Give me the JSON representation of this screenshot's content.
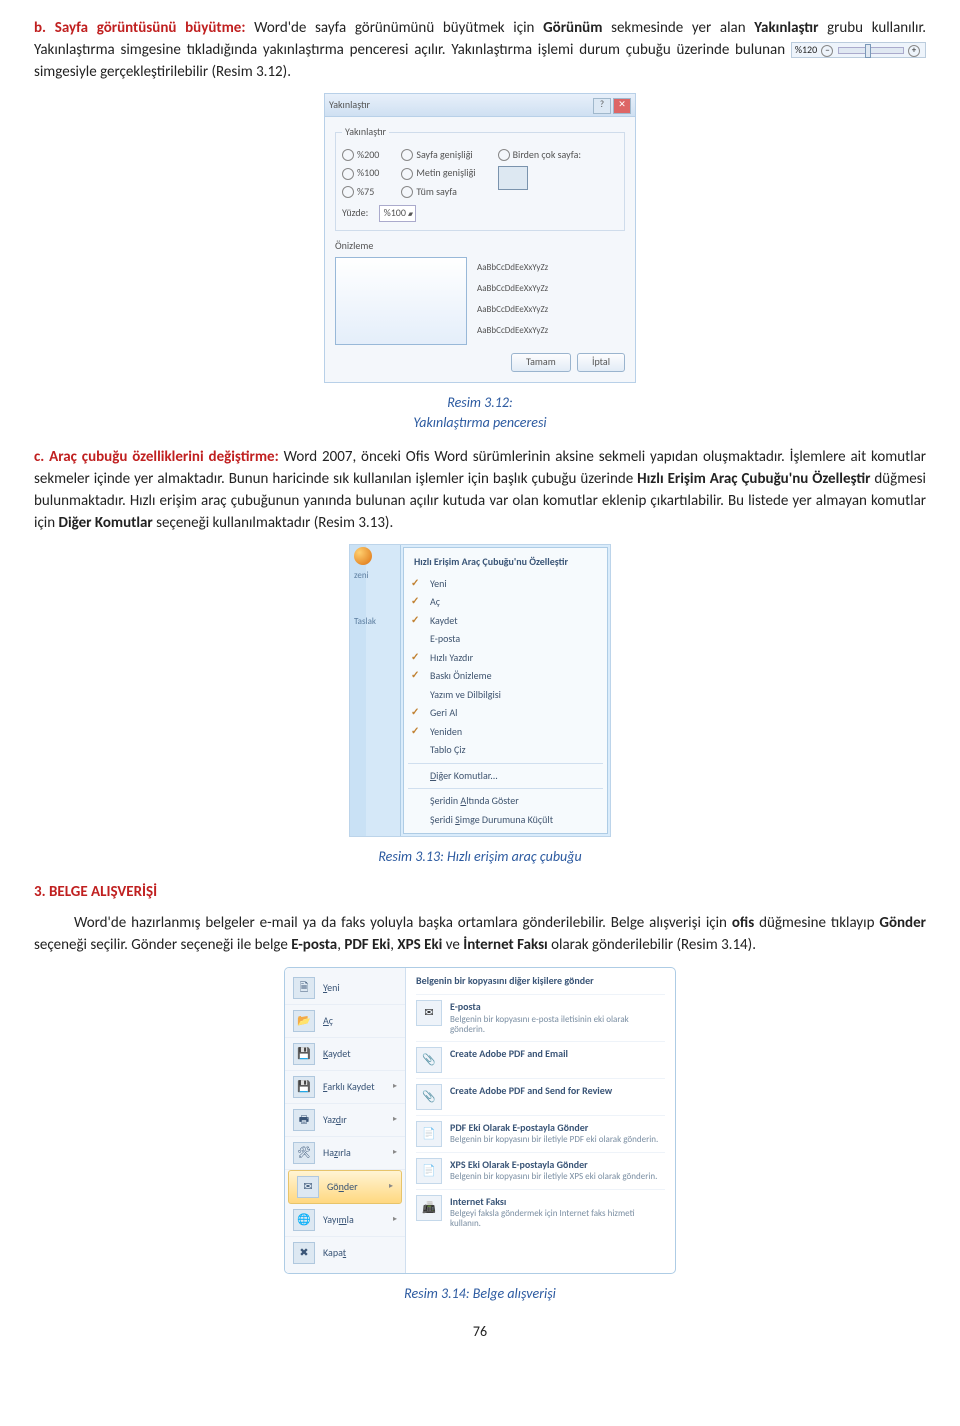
{
  "para_b": {
    "lead": "b. Sayfa görüntüsünü büyütme:",
    "text1": " Word'de sayfa görünümünü büyütmek için ",
    "bold1": "Görünüm",
    "text2": " sekmesinde yer alan ",
    "bold2": "Yakınlaştır",
    "text3": " grubu kullanılır. Yakınlaştırma simgesine tıkladığında yakınlaştırma penceresi açılır. Yakınlaştırma işlemi durum çubuğu üzerinde bulunan ",
    "text4": " simgesiyle gerçekleştirilebilir (Resim 3.12)."
  },
  "zoom_inline": "%120",
  "zoom_dialog": {
    "title": "Yakınlaştır",
    "legend": "Yakınlaştır",
    "r200": "%200",
    "r100": "%100",
    "r75": "%75",
    "pagew": "Sayfa genişliği",
    "textw": "Metin genişliği",
    "whole": "Tüm sayfa",
    "manypage": "Birden çok sayfa:",
    "percent_label": "Yüzde:",
    "percent_val": "%100",
    "preview_label": "Önizleme",
    "sample": "AaBbCcDdEeXxYyZz",
    "ok": "Tamam",
    "cancel": "İptal"
  },
  "cap312a": "Resim 3.12:",
  "cap312b": "Yakınlaştırma penceresi",
  "para_c": {
    "lead": "c. Araç çubuğu özelliklerini değiştirme:",
    "text1": " Word 2007, önceki Ofis Word sürümlerinin aksine sekmeli yapıdan oluşmaktadır. İşlemlere ait komutlar sekmeler içinde yer almaktadır. Bunun haricinde sık kullanılan işlemler için başlık çubuğu üzerinde ",
    "bold1": "Hızlı Erişim Araç Çubuğu'nu Özelleştir",
    "text2": " düğmesi bulunmaktadır. Hızlı erişim araç çubuğunun yanında bulunan açılır kutuda var olan komutlar eklenip çıkartılabilir. Bu listede yer almayan komutlar için ",
    "bold2": "Diğer Komutlar",
    "text3": " seçeneği kullanılmaktadır (Resim 3.13)."
  },
  "qat": {
    "left1": "zeni",
    "left2": "Taslak",
    "header": "Hızlı Erişim Araç Çubuğu'nu Özelleştir",
    "items": [
      "Yeni",
      "Aç",
      "Kaydet",
      "E-posta",
      "Hızlı Yazdır",
      "Baskı Önizleme",
      "Yazım ve Dilbilgisi",
      "Geri Al",
      "Yeniden",
      "Tablo Çiz"
    ],
    "more": "Diğer Komutlar...",
    "below": "Şeridin Altında Göster",
    "minimize": "Şeridi Simge Durumuna Küçült"
  },
  "cap313": "Resim 3.13: Hızlı erişim araç çubuğu",
  "section3": "3. BELGE ALIŞVERİŞİ",
  "para3": {
    "text1": "Word'de hazırlanmış belgeler e-mail ya da faks yoluyla başka ortamlara gönderilebilir. Belge alışverişi için ",
    "bold1": "ofis",
    "text2": " düğmesine tıklayıp ",
    "bold2": "Gönder",
    "text3": " seçeneği seçilir. Gönder seçeneği ile belge ",
    "bold3": "E-posta",
    "text4": ", ",
    "bold4": "PDF Eki",
    "text5": ", ",
    "bold5": "XPS Eki",
    "text6": " ve ",
    "bold6": "İnternet Faksı",
    "text7": " olarak gönderilebilir  (Resim 3.14)."
  },
  "send": {
    "left": [
      "Yeni",
      "Aç",
      "Kaydet",
      "Farklı Kaydet",
      "Yazdır",
      "Hazırla",
      "Gönder",
      "Yayımla",
      "Kapat"
    ],
    "header": "Belgenin bir kopyasını diğer kişilere gönder",
    "r1t": "E-posta",
    "r1s": "Belgenin bir kopyasını e-posta iletisinin eki olarak gönderin.",
    "r2t": "Create Adobe PDF and Email",
    "r3t": "Create Adobe PDF and Send for Review",
    "r4t": "PDF Eki Olarak E-postayla Gönder",
    "r4s": "Belgenin bir kopyasını bir iletiyle PDF eki olarak gönderin.",
    "r5t": "XPS Eki Olarak E-postayla Gönder",
    "r5s": "Belgenin bir kopyasını bir iletiyle XPS eki olarak gönderin.",
    "r6t": "Internet Faksı",
    "r6s": "Belgeyi faksla göndermek için Internet faks hizmeti kullanın."
  },
  "cap314": "Resim 3.14: Belge alışverişi",
  "pagenum": "76"
}
